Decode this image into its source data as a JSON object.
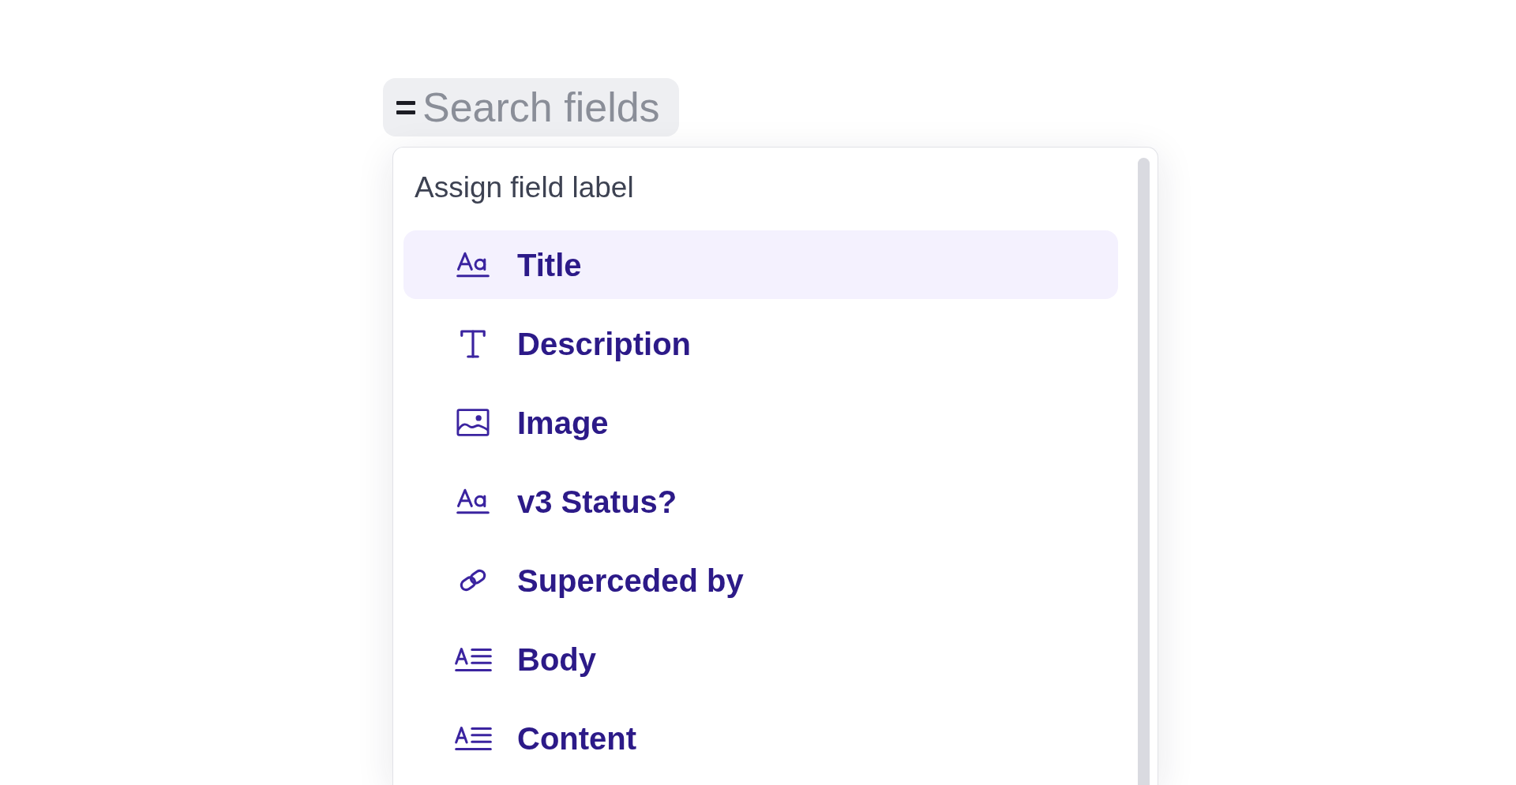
{
  "search": {
    "placeholder": "Search fields"
  },
  "menu": {
    "heading": "Assign field label",
    "items": [
      {
        "label": "Title",
        "kind": "text",
        "selected": true
      },
      {
        "label": "Description",
        "kind": "plaintext",
        "selected": false
      },
      {
        "label": "Image",
        "kind": "image",
        "selected": false
      },
      {
        "label": "v3 Status?",
        "kind": "text",
        "selected": false
      },
      {
        "label": "Superceded by",
        "kind": "link",
        "selected": false
      },
      {
        "label": "Body",
        "kind": "richtext",
        "selected": false
      },
      {
        "label": "Content",
        "kind": "richtext",
        "selected": false
      }
    ]
  }
}
